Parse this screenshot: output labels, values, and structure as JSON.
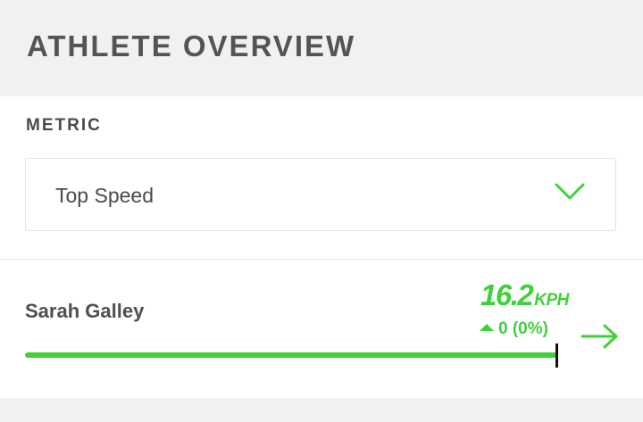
{
  "header": {
    "title": "ATHLETE OVERVIEW"
  },
  "metric": {
    "label": "METRIC",
    "selected": "Top Speed",
    "dropdown_icon": "chevron-down-icon"
  },
  "athlete": {
    "name": "Sarah Galley",
    "value": "16.2",
    "unit": "KPH",
    "change_icon": "triangle-up-icon",
    "change": "0 (0%)",
    "bar_fraction": 1.0,
    "arrow_icon": "arrow-right-icon"
  },
  "colors": {
    "accent": "#3fd13a",
    "text": "#4a4a4a",
    "marker": "#111111"
  }
}
